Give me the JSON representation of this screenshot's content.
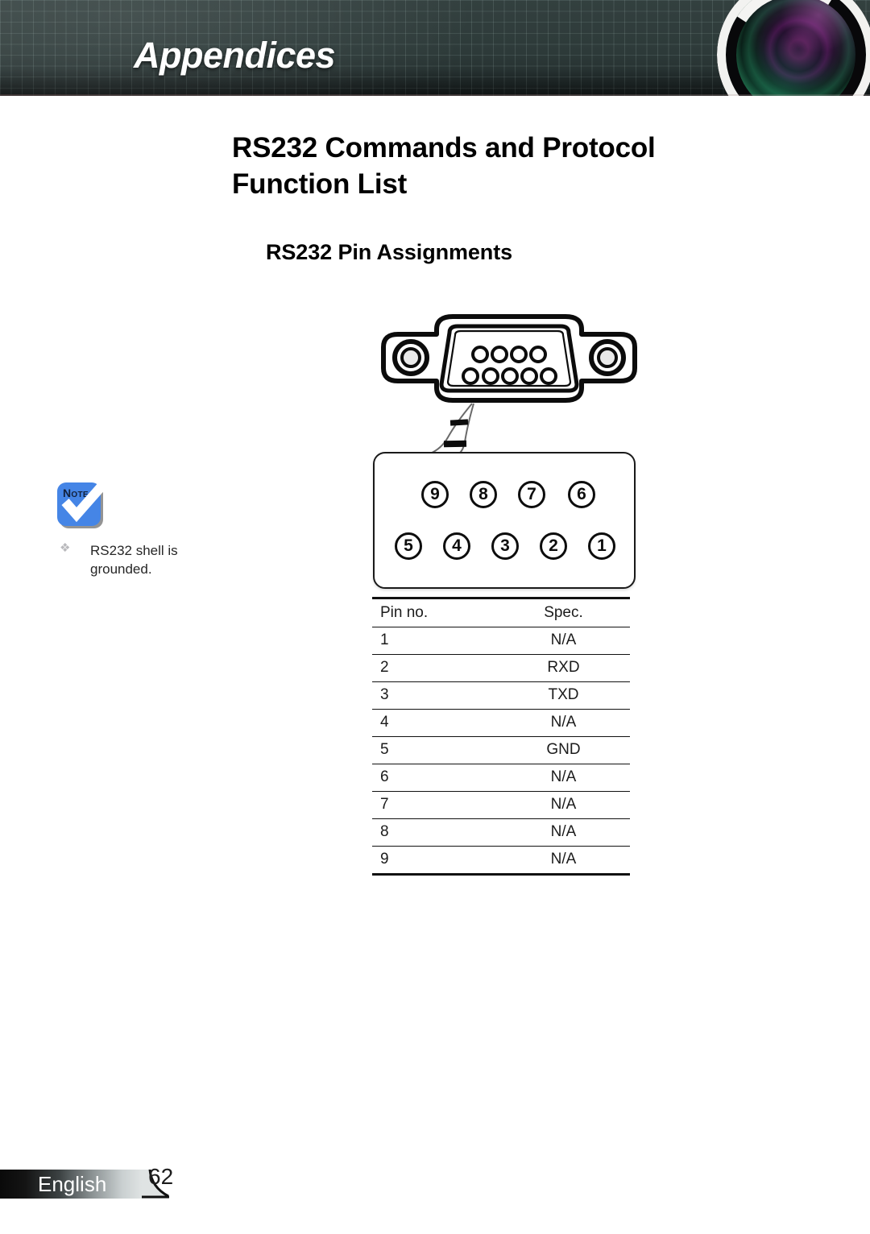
{
  "header": {
    "title": "Appendices",
    "lens_image": "projector-lens-photo"
  },
  "page": {
    "title": "RS232 Commands and Protocol Function List",
    "section_title": "RS232 Pin Assignments"
  },
  "note": {
    "icon_label": "Note",
    "bullet": "❖",
    "text": "RS232 shell is grounded."
  },
  "connector": {
    "caption": "db9-female-connector",
    "top_row_holes": 4,
    "bottom_row_holes": 5
  },
  "callout": {
    "top_row": [
      "9",
      "8",
      "7",
      "6"
    ],
    "bottom_row": [
      "5",
      "4",
      "3",
      "2",
      "1"
    ]
  },
  "pin_table": {
    "headers": [
      "Pin no.",
      "Spec."
    ],
    "rows": [
      {
        "pin": "1",
        "spec": "N/A"
      },
      {
        "pin": "2",
        "spec": "RXD"
      },
      {
        "pin": "3",
        "spec": "TXD"
      },
      {
        "pin": "4",
        "spec": "N/A"
      },
      {
        "pin": "5",
        "spec": "GND"
      },
      {
        "pin": "6",
        "spec": "N/A"
      },
      {
        "pin": "7",
        "spec": "N/A"
      },
      {
        "pin": "8",
        "spec": "N/A"
      },
      {
        "pin": "9",
        "spec": "N/A"
      }
    ]
  },
  "footer": {
    "language": "English",
    "page_number": "62"
  },
  "colors": {
    "header_bg": "#2d3a39",
    "note_blue": "#4585e6",
    "text": "#1b1b1b"
  }
}
